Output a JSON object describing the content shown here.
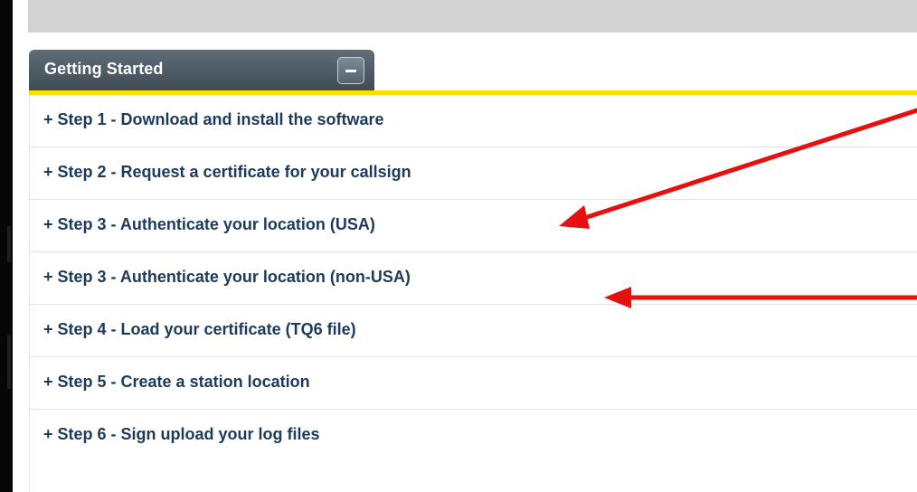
{
  "panel": {
    "title": "Getting Started",
    "collapse_symbol": "–"
  },
  "steps": [
    {
      "label": "+ Step 1 - Download and install the software"
    },
    {
      "label": "+ Step 2 - Request a certificate for your callsign"
    },
    {
      "label": "+ Step 3 - Authenticate your location (USA)"
    },
    {
      "label": "+ Step 3 - Authenticate your location (non-USA)"
    },
    {
      "label": "+ Step 4 - Load your certificate (TQ6 file)"
    },
    {
      "label": "+ Step 5 - Create a station location"
    },
    {
      "label": "+ Step 6 - Sign upload your log files"
    }
  ],
  "colors": {
    "tab_background": "#4a5863",
    "accent_line": "#f7df00",
    "step_text": "#1b3a5c",
    "annotation_arrow": "#e8100e"
  },
  "annotations": [
    {
      "type": "arrow",
      "points_to": "+ Step 3 - Authenticate your location (USA)",
      "color": "#e8100e"
    },
    {
      "type": "arrow",
      "points_to": "+ Step 3 - Authenticate your location (non-USA)",
      "color": "#e8100e"
    }
  ]
}
